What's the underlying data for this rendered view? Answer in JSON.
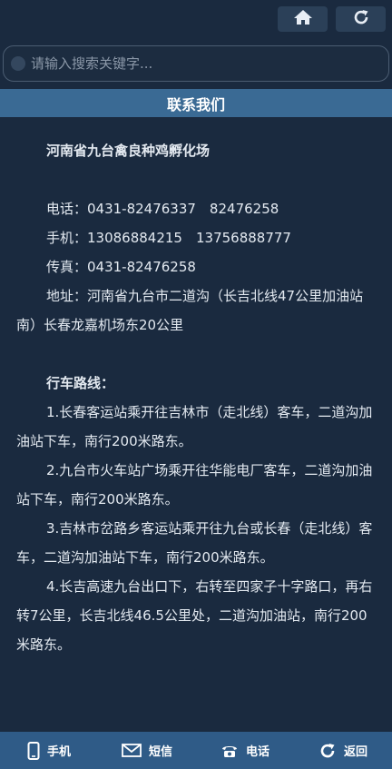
{
  "top": {
    "home_icon": "home-icon",
    "refresh_icon": "refresh-icon"
  },
  "search": {
    "placeholder": "请输入搜索关键字..."
  },
  "section": {
    "title": "联系我们"
  },
  "content": {
    "company": "河南省九台禽良种鸡孵化场",
    "phone": "电话：0431-82476337　82476258",
    "mobile": "手机：13086884215　13756888777",
    "fax": "传真：0431-82476258",
    "address": "地址：河南省九台市二道沟（长吉北线47公里加油站南）长春龙嘉机场东20公里",
    "route_title": "行车路线：",
    "routes": [
      "1.长春客运站乘开往吉林市（走北线）客车，二道沟加油站下车，南行200米路东。",
      "2.九台市火车站广场乘开往华能电厂客车，二道沟加油站下车，南行200米路东。",
      "3.吉林市岔路乡客运站乘开往九台或长春（走北线）客车，二道沟加油站下车，南行200米路东。",
      "4.长吉高速九台出口下，右转至四家子十字路口，再右转7公里，长吉北线46.5公里处，二道沟加油站，南行200米路东。"
    ]
  },
  "bottom": {
    "items": [
      {
        "label": "手机",
        "icon": "mobile-phone-icon"
      },
      {
        "label": "短信",
        "icon": "envelope-icon"
      },
      {
        "label": "电话",
        "icon": "telephone-icon"
      },
      {
        "label": "返回",
        "icon": "back-refresh-icon"
      }
    ]
  },
  "colors": {
    "background": "#1a2a3f",
    "section_bar": "#3a6a94",
    "bottom_bar": "#2f5b87"
  }
}
